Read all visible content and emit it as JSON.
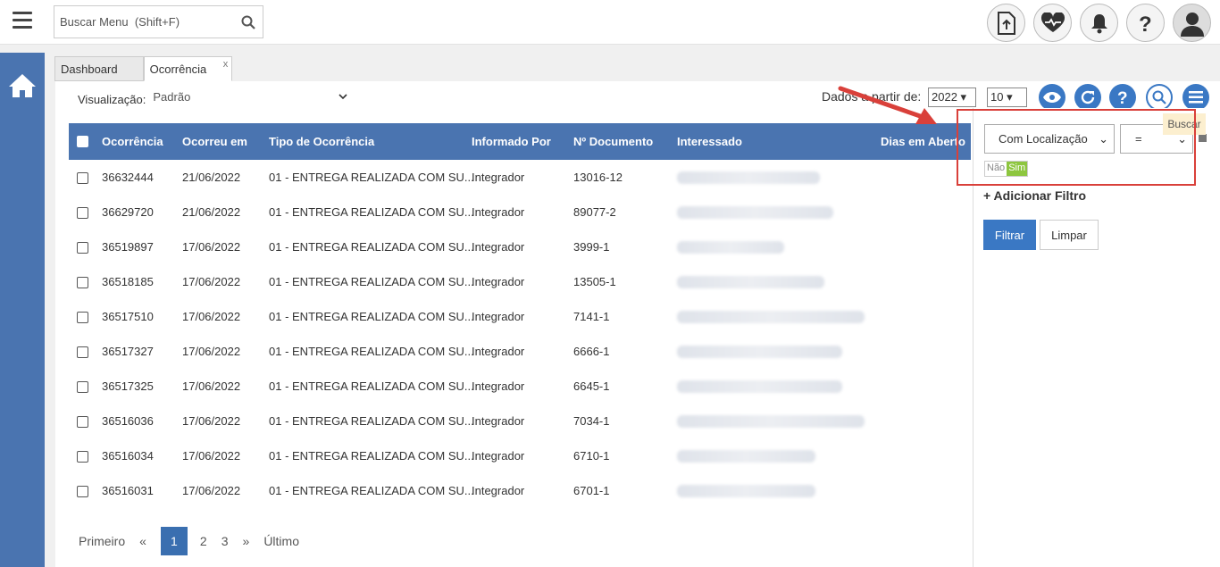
{
  "topbar": {
    "search_placeholder": "Buscar Menu  (Shift+F)"
  },
  "tabs": [
    {
      "label": "Dashboard"
    },
    {
      "label": "Ocorrência",
      "close": "x"
    }
  ],
  "toolbar": {
    "viz_label": "Visualização:",
    "viz_value": "Padrão",
    "dados_label": "Dados a partir de:",
    "year_value": "2022",
    "page_size": "10"
  },
  "grid": {
    "columns": [
      "Ocorrência",
      "Ocorreu em",
      "Tipo de Ocorrência",
      "Informado Por",
      "Nº Documento",
      "Interessado",
      "Dias em Aberto"
    ],
    "rows": [
      {
        "id": "36632444",
        "date": "21/06/2022",
        "tipo": "01 - ENTREGA REALIZADA COM SU...",
        "informado": "Integrador",
        "doc": "13016-12"
      },
      {
        "id": "36629720",
        "date": "21/06/2022",
        "tipo": "01 - ENTREGA REALIZADA COM SU...",
        "informado": "Integrador",
        "doc": "89077-2"
      },
      {
        "id": "36519897",
        "date": "17/06/2022",
        "tipo": "01 - ENTREGA REALIZADA COM SU...",
        "informado": "Integrador",
        "doc": "3999-1"
      },
      {
        "id": "36518185",
        "date": "17/06/2022",
        "tipo": "01 - ENTREGA REALIZADA COM SU...",
        "informado": "Integrador",
        "doc": "13505-1"
      },
      {
        "id": "36517510",
        "date": "17/06/2022",
        "tipo": "01 - ENTREGA REALIZADA COM SU...",
        "informado": "Integrador",
        "doc": "7141-1"
      },
      {
        "id": "36517327",
        "date": "17/06/2022",
        "tipo": "01 - ENTREGA REALIZADA COM SU...",
        "informado": "Integrador",
        "doc": "6666-1"
      },
      {
        "id": "36517325",
        "date": "17/06/2022",
        "tipo": "01 - ENTREGA REALIZADA COM SU...",
        "informado": "Integrador",
        "doc": "6645-1"
      },
      {
        "id": "36516036",
        "date": "17/06/2022",
        "tipo": "01 - ENTREGA REALIZADA COM SU...",
        "informado": "Integrador",
        "doc": "7034-1"
      },
      {
        "id": "36516034",
        "date": "17/06/2022",
        "tipo": "01 - ENTREGA REALIZADA COM SU...",
        "informado": "Integrador",
        "doc": "6710-1"
      },
      {
        "id": "36516031",
        "date": "17/06/2022",
        "tipo": "01 - ENTREGA REALIZADA COM SU...",
        "informado": "Integrador",
        "doc": "6701-1"
      }
    ]
  },
  "pager": {
    "first": "Primeiro",
    "prev": "«",
    "pages": [
      "1",
      "2",
      "3"
    ],
    "next": "»",
    "last": "Último"
  },
  "filter_panel": {
    "field_value": "Com Localização",
    "operator_value": "=",
    "toggle_off": "Não",
    "toggle_on": "Sim",
    "add_filter": "+ Adicionar Filtro",
    "filter_button": "Filtrar",
    "clear_button": "Limpar",
    "tooltip": "Buscar"
  },
  "colors": {
    "primary": "#4a74b0",
    "button_blue": "#3a78c4",
    "toggle_green": "#8dc63f",
    "highlight_red": "#d9403a"
  }
}
